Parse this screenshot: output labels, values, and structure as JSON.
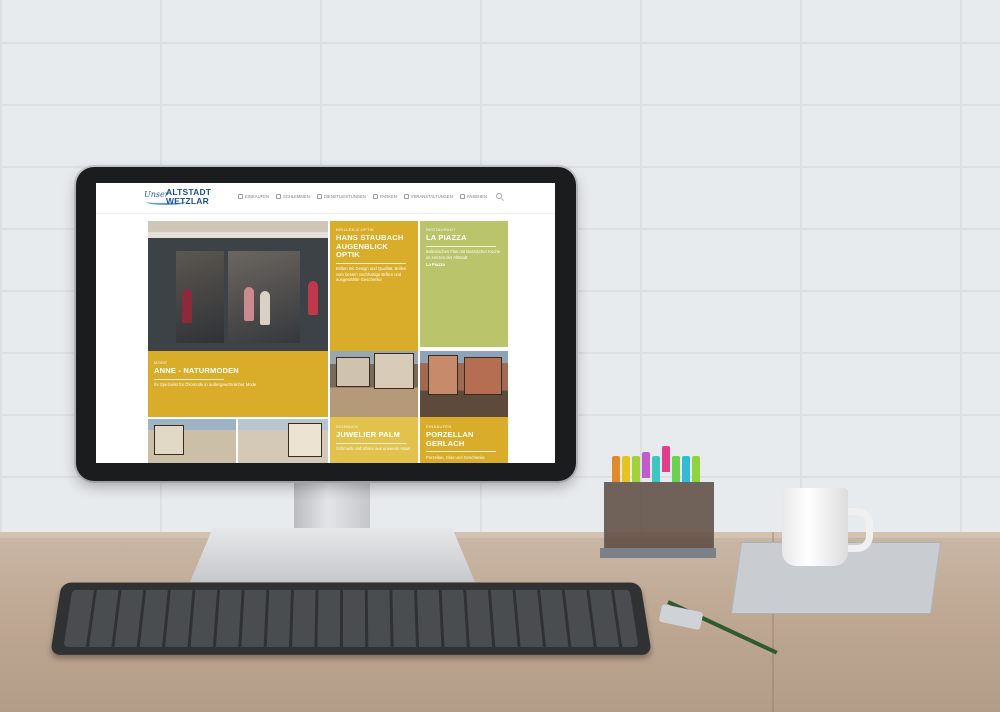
{
  "site": {
    "logo": {
      "script": "Unser",
      "main_line1": "ALTSTADT",
      "main_line2": "WETZLAR"
    },
    "nav": [
      {
        "label": "EINKAUFEN",
        "icon": "shopping-bag-icon"
      },
      {
        "label": "SCHLEMMEN",
        "icon": "restaurant-icon"
      },
      {
        "label": "DIENSTLEISTUNGEN",
        "icon": "services-icon"
      },
      {
        "label": "PARKEN",
        "icon": "parking-icon"
      },
      {
        "label": "VERANSTALTUNGEN",
        "icon": "events-icon"
      },
      {
        "label": "ANSEHEN",
        "icon": "sightseeing-icon"
      }
    ]
  },
  "tiles": {
    "staubach": {
      "category": "BRILLEN & OPTIK",
      "title": "HANS STAUBACH AUGENBLICK OPTIK",
      "desc": "Brillen mit Design und Qualität, Brillen vom besten nachhaltige Brillen und ausgewählte Geschenke"
    },
    "piazza": {
      "category": "RESTAURANT",
      "title": "LA PIAZZA",
      "desc": "Italienisches Flair mit klassischer Küche im Herzen der Altstadt",
      "link": "La Piazza"
    },
    "anne": {
      "category": "MODE",
      "title": "ANNE - NATURMODEN",
      "desc": "Ihr Spezialist für Ökomode in außergewöhnlicher Mode"
    },
    "palm": {
      "category": "SCHMUCK",
      "title": "JUWELIER PALM",
      "desc": "Schmuck und Uhren aus unserem Haus"
    },
    "gerlach": {
      "category": "EINKAUFEN",
      "title": "PORZELLAN GERLACH",
      "desc": "Porzellan, Glas und Geschenke"
    }
  },
  "colors": {
    "mustard": "#d9ad2a",
    "olive": "#b9c46b",
    "brand_blue": "#1f4f93"
  }
}
